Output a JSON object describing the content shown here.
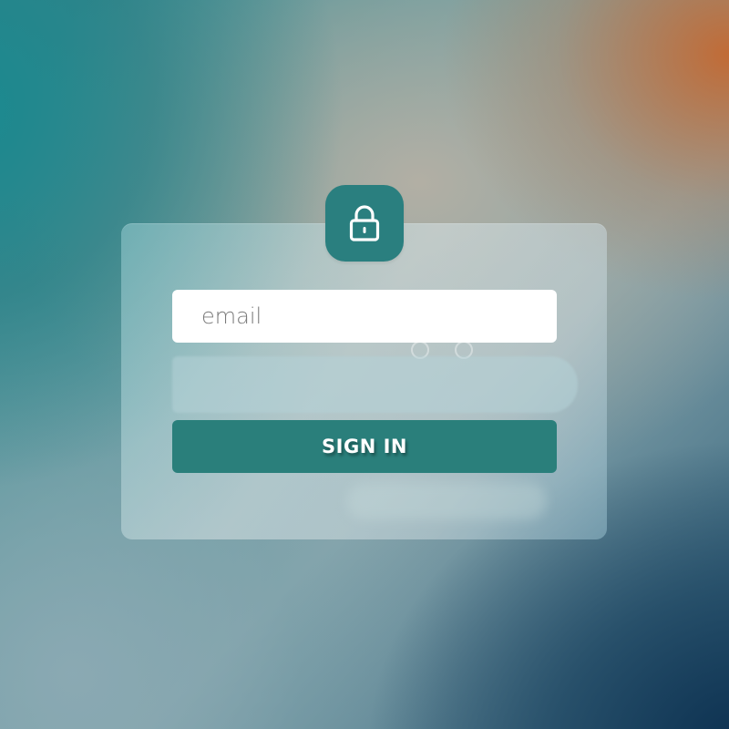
{
  "login_form": {
    "icon": "lock-icon",
    "email_placeholder": "email",
    "email_value": "",
    "password_value": "",
    "submit_label": "SIGN IN"
  },
  "colors": {
    "accent": "#2a7f7b",
    "input_background": "#ffffff",
    "card_background": "rgba(200,218,222,0.55)"
  }
}
